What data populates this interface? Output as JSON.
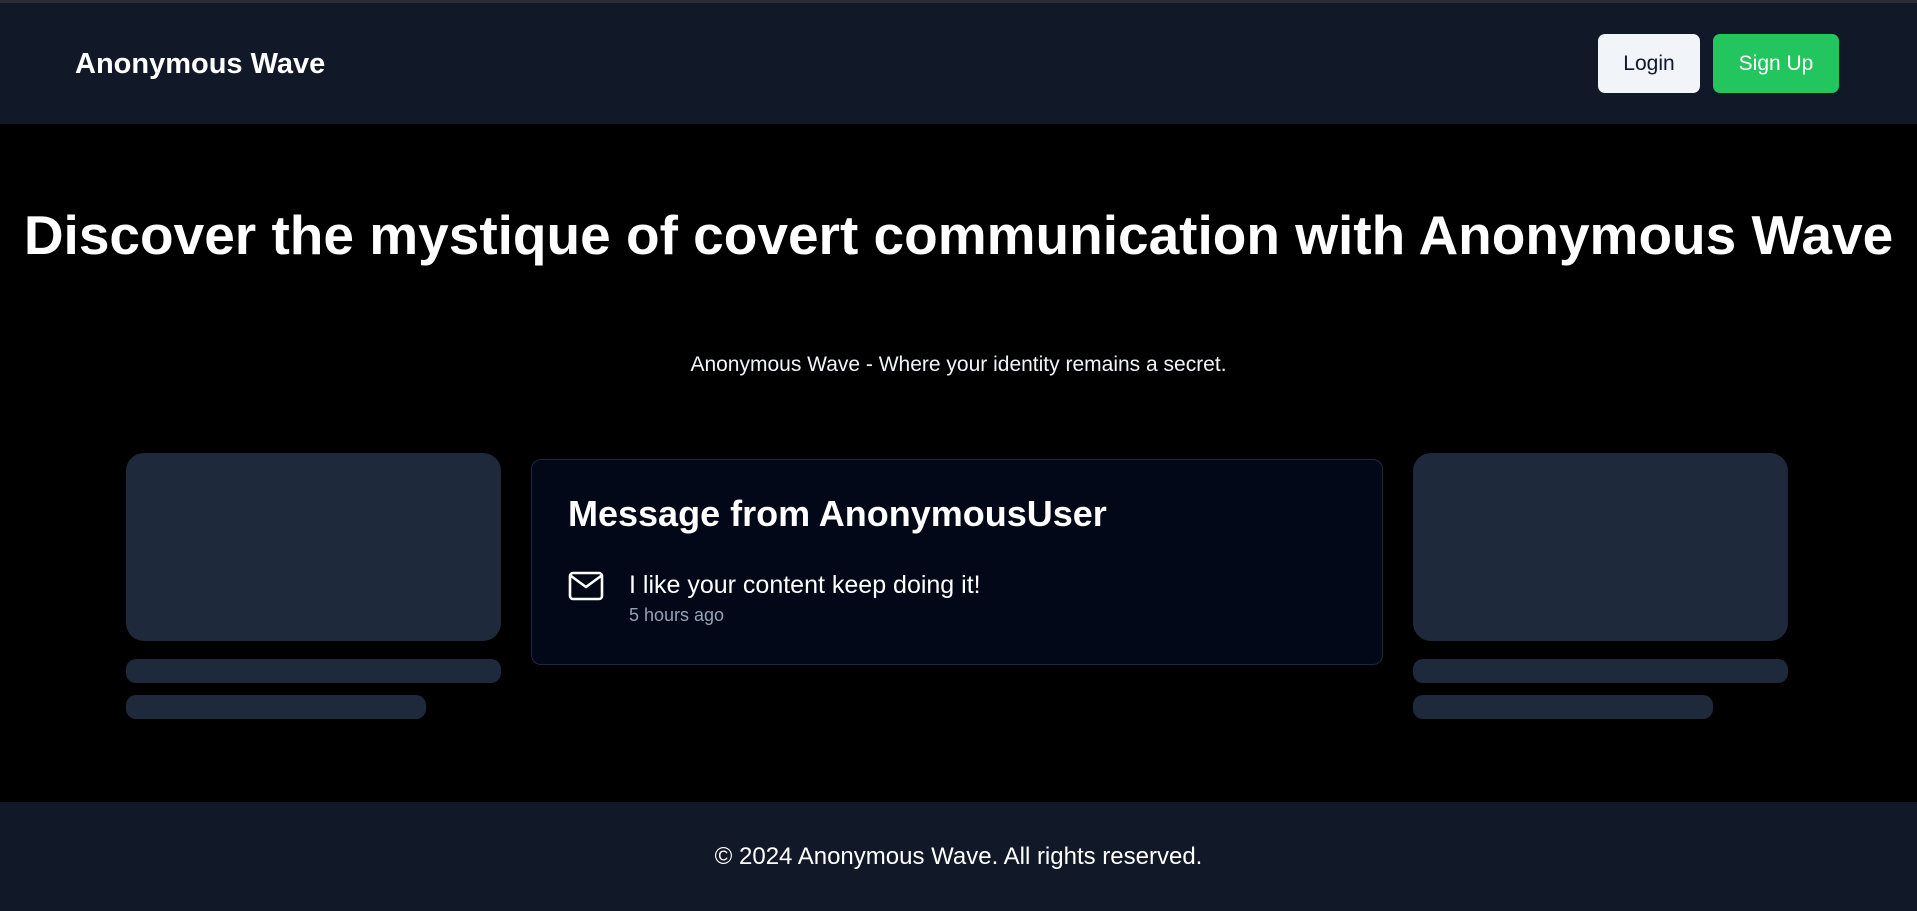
{
  "header": {
    "brand": "Anonymous Wave",
    "login_label": "Login",
    "signup_label": "Sign Up"
  },
  "hero": {
    "title": "Discover the mystique of covert communication with Anonymous Wave",
    "subtitle": "Anonymous Wave - Where your identity remains a secret."
  },
  "message_card": {
    "title": "Message from AnonymousUser",
    "icon": "mail-icon",
    "text": "I like your content keep doing it!",
    "time": "5 hours ago"
  },
  "footer": {
    "copyright": "© 2024 Anonymous Wave. All rights reserved."
  },
  "colors": {
    "page_background": "#000000",
    "header_background": "#111827",
    "skeleton": "#1e293b",
    "card_background": "#020817",
    "signup_accent": "#22c55e",
    "login_background": "#f1f5f9",
    "muted_text": "#94a3b8"
  }
}
